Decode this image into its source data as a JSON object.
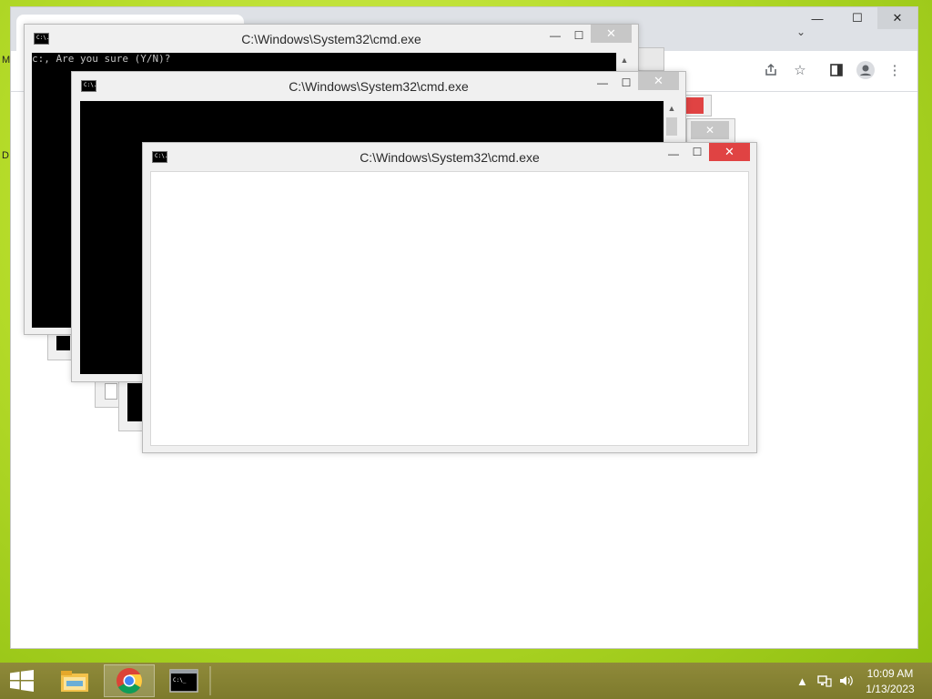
{
  "browser": {
    "window_controls": {
      "minimize": "—",
      "maximize": "☐",
      "close": "✕"
    },
    "tab_search_icon": "chevron-down-icon",
    "toolbar_icons": [
      "share-icon",
      "bookmark-star-icon",
      "side-panel-icon",
      "profile-icon",
      "menu-kebab-icon"
    ],
    "edge_letters": [
      "M",
      "D"
    ]
  },
  "cmd_windows": [
    {
      "title": "C:\\Windows\\System32\\cmd.exe",
      "console_text": "c:, Are you sure (Y/N)?"
    },
    {
      "title": "C:\\Windows\\System32\\cmd.exe",
      "console_text": ""
    },
    {
      "title": "C:\\Windows\\System32\\cmd.exe",
      "console_text": ""
    }
  ],
  "cmd_controls": {
    "minimize": "—",
    "maximize": "☐",
    "close": "✕",
    "app_icon_text": "C:\\."
  },
  "taskbar": {
    "items": [
      "file-explorer-icon",
      "chrome-icon",
      "cmd-icon"
    ],
    "active": "chrome-icon",
    "tray_icons": [
      "tray-chevron-up-icon",
      "network-icon",
      "volume-icon"
    ],
    "clock": {
      "time": "10:09 AM",
      "date": "1/13/2023"
    }
  },
  "colors": {
    "desktop": "#b6dc2a",
    "taskbar": "#8a8535",
    "close_active": "#e04343"
  }
}
